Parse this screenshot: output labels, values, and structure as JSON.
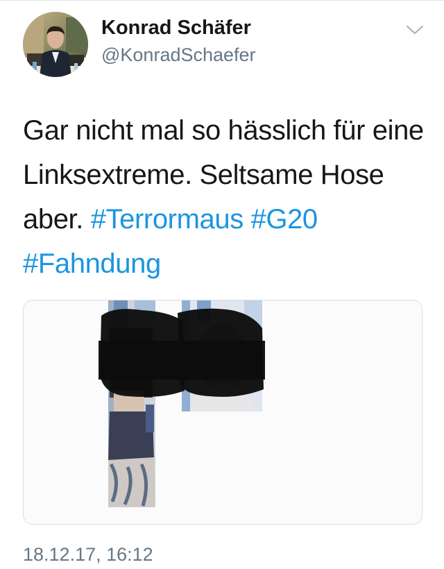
{
  "tweet": {
    "author": {
      "display_name": "Konrad Schäfer",
      "handle": "@KonradSchaefer"
    },
    "text": {
      "plain": "Gar nicht mal so hässlich für eine Linksextreme. Seltsame Hose aber.",
      "hashtags": [
        "#Terrormaus",
        "#G20",
        "#Fahndung"
      ]
    },
    "timestamp": "18.12.17, 16:12",
    "menu_icon": "chevron-down-icon",
    "media": {
      "type": "photo-collage",
      "faces_redacted": true
    }
  },
  "colors": {
    "text": "#14171a",
    "secondary_text": "#657786",
    "link": "#1b95e0",
    "border": "#d8dee2",
    "chevron": "#aab8c2",
    "redaction": "#0d0d0d"
  }
}
